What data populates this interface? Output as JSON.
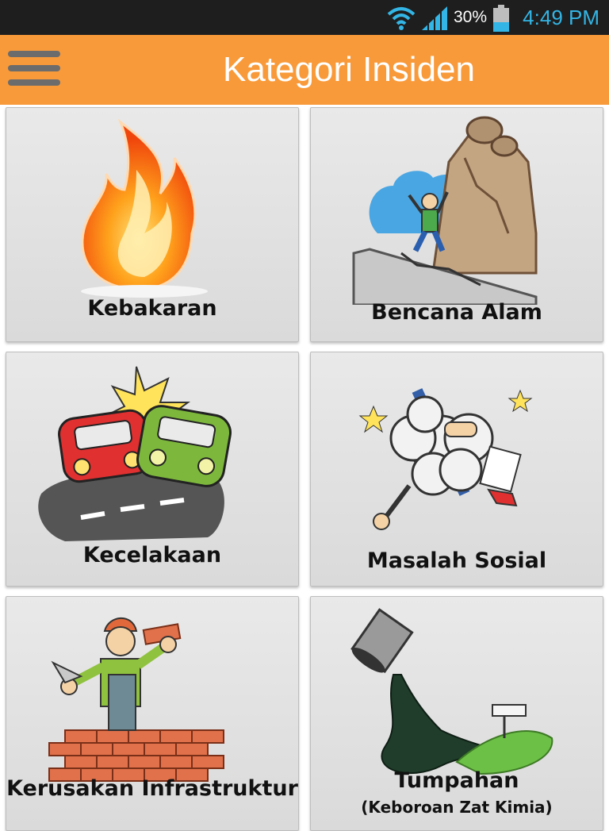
{
  "status_bar": {
    "battery_percent": "30%",
    "time": "4:49 PM"
  },
  "app_bar": {
    "title": "Kategori Insiden"
  },
  "categories": [
    {
      "label": "Kebakaran",
      "icon": "fire-icon"
    },
    {
      "label": "Bencana Alam",
      "icon": "landslide-icon"
    },
    {
      "label": "Kecelakaan",
      "icon": "car-crash-icon"
    },
    {
      "label": "Masalah Sosial",
      "icon": "fight-icon"
    },
    {
      "label": "Kerusakan Infrastruktur",
      "icon": "construction-worker-icon"
    },
    {
      "label": "Tumpahan",
      "sublabel": "(Keboroan Zat Kimia)",
      "icon": "chemical-spill-icon"
    }
  ],
  "colors": {
    "app_bar": "#f99a3a",
    "status_bar": "#1e1e1e",
    "status_accent": "#33b5e5"
  }
}
